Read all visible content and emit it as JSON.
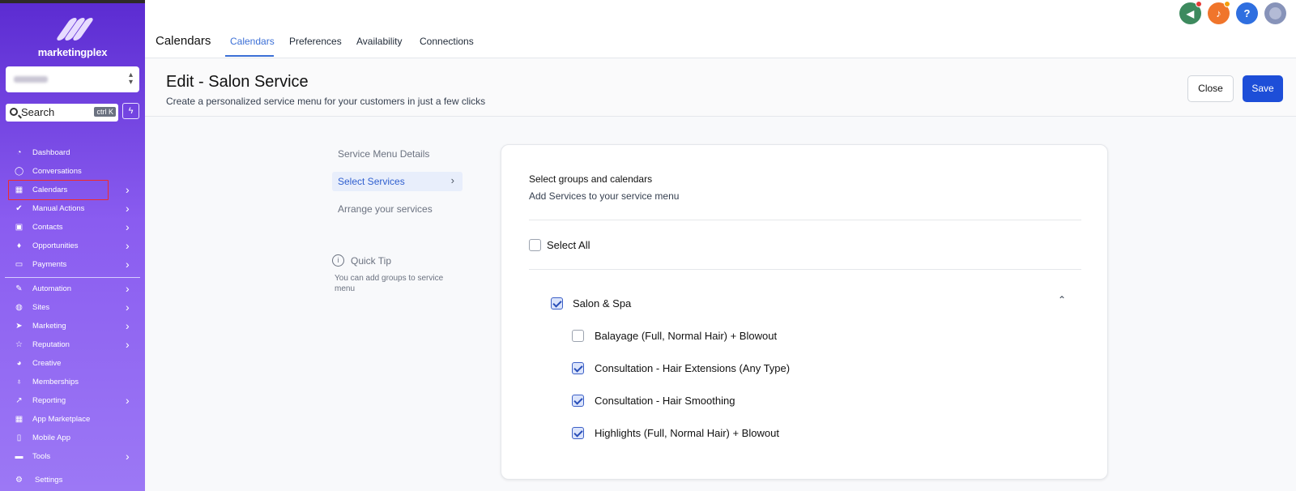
{
  "sidebar": {
    "brand": "marketingplex",
    "location_caret": "⌃⌄",
    "search": {
      "label": "Search",
      "shortcut": "ctrl K"
    },
    "quick_action_icon": "lightning-icon",
    "items": [
      {
        "label": "Dashboard",
        "icon": "dashboard-icon",
        "glyph": "◔"
      },
      {
        "label": "Conversations",
        "icon": "chat-icon",
        "glyph": "◯"
      },
      {
        "label": "Calendars",
        "icon": "calendar-icon",
        "glyph": "▦"
      },
      {
        "label": "Manual Actions",
        "icon": "check-circle-icon",
        "glyph": "✔"
      },
      {
        "label": "Contacts",
        "icon": "contacts-icon",
        "glyph": "▣"
      },
      {
        "label": "Opportunities",
        "icon": "opportunities-icon",
        "glyph": "♦"
      },
      {
        "label": "Payments",
        "icon": "card-icon",
        "glyph": "▭"
      },
      {
        "label": "Automation",
        "icon": "automation-icon",
        "glyph": "✎"
      },
      {
        "label": "Sites",
        "icon": "globe-icon",
        "glyph": "◍"
      },
      {
        "label": "Marketing",
        "icon": "send-icon",
        "glyph": "➤"
      },
      {
        "label": "Reputation",
        "icon": "star-icon",
        "glyph": "☆"
      },
      {
        "label": "Creative",
        "icon": "palette-icon",
        "glyph": "◕"
      },
      {
        "label": "Memberships",
        "icon": "award-icon",
        "glyph": "♁"
      },
      {
        "label": "Reporting",
        "icon": "chart-icon",
        "glyph": "↗"
      },
      {
        "label": "App Marketplace",
        "icon": "grid-icon",
        "glyph": "▦"
      },
      {
        "label": "Mobile App",
        "icon": "phone-icon",
        "glyph": "▯"
      },
      {
        "label": "Tools",
        "icon": "toolbox-icon",
        "glyph": "▬"
      },
      {
        "label": "Settings",
        "icon": "gear-icon",
        "glyph": "⚙"
      }
    ]
  },
  "topbar": {
    "title": "Calendars",
    "tabs": [
      {
        "label": "Calendars",
        "active": true
      },
      {
        "label": "Preferences",
        "active": false
      },
      {
        "label": "Availability",
        "active": false
      },
      {
        "label": "Connections",
        "active": false
      }
    ],
    "icons": {
      "announce": {
        "glyph": "📢",
        "color": "#3d8a5e"
      },
      "notify": {
        "glyph": "🔔",
        "color": "#f0752b"
      },
      "help": {
        "glyph": "?",
        "color": "#2f6fe0"
      },
      "avatar": {
        "color": "#8793b9"
      }
    }
  },
  "header": {
    "title": "Edit - Salon Service",
    "subtitle": "Create a personalized service menu for your customers in just a few clicks",
    "close_label": "Close",
    "save_label": "Save"
  },
  "steps": [
    {
      "label": "Service Menu Details",
      "active": false
    },
    {
      "label": "Select Services",
      "active": true,
      "chevron": "›"
    },
    {
      "label": "Arrange your services",
      "active": false
    }
  ],
  "tip": {
    "icon_glyph": "i",
    "title": "Quick Tip",
    "text": "You can add groups to service menu"
  },
  "card": {
    "title": "Select groups and calendars",
    "subtitle": "Add Services to your service menu",
    "select_all_label": "Select All",
    "select_all_checked": false,
    "group": {
      "label": "Salon & Spa",
      "checked": true,
      "collapse_glyph": "⌃"
    },
    "services": [
      {
        "label": "Balayage (Full, Normal Hair) + Blowout",
        "checked": false
      },
      {
        "label": "Consultation - Hair Extensions (Any Type)",
        "checked": true
      },
      {
        "label": "Consultation - Hair Smoothing",
        "checked": true
      },
      {
        "label": "Highlights (Full, Normal Hair) + Blowout",
        "checked": true
      }
    ]
  },
  "colors": {
    "accent": "#1d4ed8",
    "sidebar": "#7a4fe6",
    "highlight_box": "#ef2b2b"
  }
}
